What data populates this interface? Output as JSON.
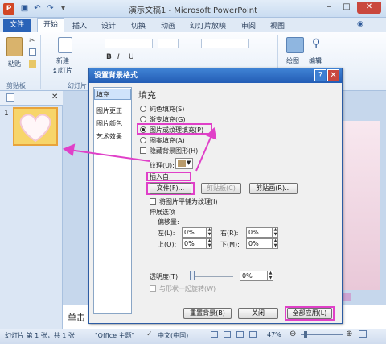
{
  "window": {
    "title": "演示文稿1 - Microsoft PowerPoint",
    "app_letter": "P"
  },
  "quick_access": {
    "save_icon": "save-icon",
    "undo_icon": "undo-icon",
    "redo_icon": "redo-icon"
  },
  "window_buttons": {
    "minimize": "–",
    "maximize": "□",
    "close": "✕"
  },
  "ribbon": {
    "file_tab": "文件",
    "tabs": [
      "开始",
      "插入",
      "设计",
      "切换",
      "动画",
      "幻灯片放映",
      "审阅",
      "视图"
    ],
    "groups": {
      "clipboard": {
        "label": "剪贴板",
        "paste": "粘贴"
      },
      "slides": {
        "label": "幻灯片",
        "new_slide": "新建",
        "new_slide_sub": "幻灯片"
      },
      "drawing": {
        "draw": "绘图",
        "edit": "编辑"
      }
    }
  },
  "left_panel": {
    "slide_number": "1"
  },
  "notes": {
    "placeholder": "单击"
  },
  "statusbar": {
    "slide_info": "幻灯片 第 1 张，共 1 张",
    "theme": "\"Office 主题\"",
    "language": "中文(中国)",
    "zoom": "47%"
  },
  "dialog": {
    "title": "设置背景格式",
    "help": "?",
    "close": "✕",
    "nav": [
      "填充",
      "图片更正",
      "图片颜色",
      "艺术效果"
    ],
    "section_title": "填充",
    "fill_options": [
      "纯色填充(S)",
      "渐变填充(G)",
      "图片或纹理填充(P)",
      "图案填充(A)"
    ],
    "selected_fill": "图片或纹理填充(P)",
    "hide_bg": "隐藏背景图形(H)",
    "texture_label": "纹理(U):",
    "insert_from_label": "插入自:",
    "file_button": "文件(F)...",
    "clipboard_button": "剪贴板(C)",
    "clipart_button": "剪贴画(R)...",
    "tile_label": "将图片平铺为纹理(I)",
    "stretch_label": "伸展选项",
    "offset_label": "偏移量:",
    "offsets": {
      "left_label": "左(L):",
      "left_value": "0%",
      "right_label": "右(R):",
      "right_value": "0%",
      "top_label": "上(O):",
      "top_value": "0%",
      "bottom_label": "下(M):",
      "bottom_value": "0%"
    },
    "transparency_label": "透明度(T):",
    "transparency_value": "0%",
    "transparency_level": 0,
    "rotate_label": "与形状一起旋转(W)",
    "reset_button": "重置背景(B)",
    "close_button": "关闭",
    "apply_all_button": "全部应用(L)"
  },
  "colors": {
    "accent": "#2a63b8",
    "highlight": "#e040c8",
    "slide_thumb": "#f7d56a"
  }
}
